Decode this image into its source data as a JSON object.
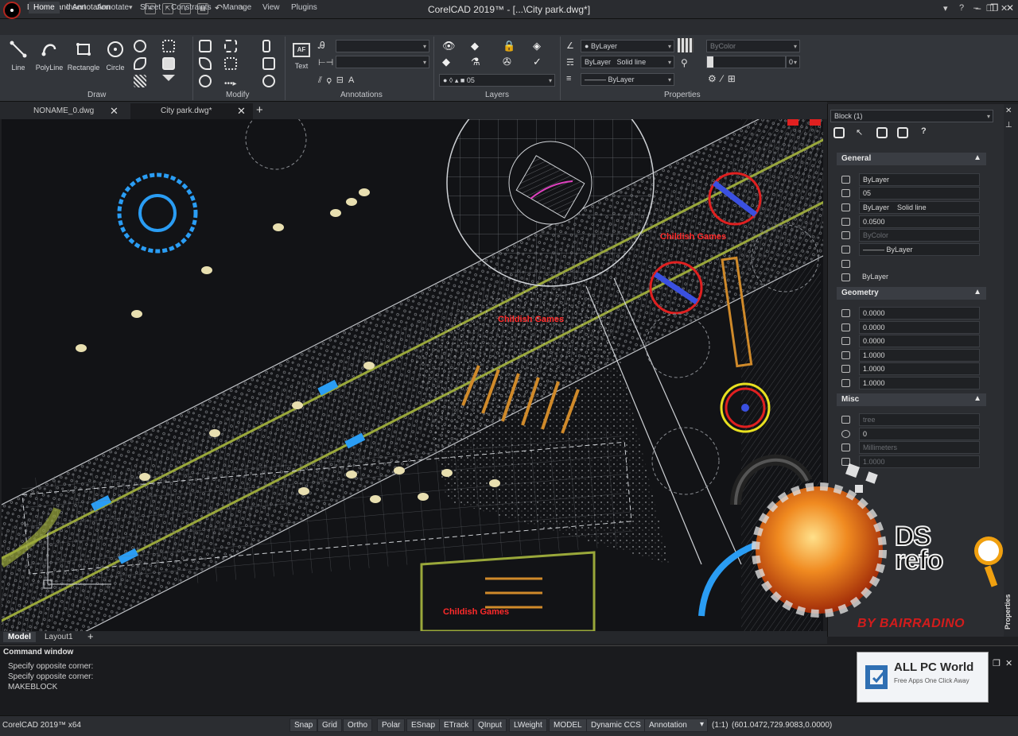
{
  "app": {
    "title": "CorelCAD 2019™ - [...\\City park.dwg*]",
    "workspace": "Drafting and Annotation",
    "window_controls": [
      "–",
      "❐",
      "✕"
    ],
    "doc_window_controls": [
      "▾",
      "?",
      "–",
      "❐",
      "✕"
    ]
  },
  "menu": {
    "tabs": [
      "Home",
      "Insert",
      "Annotate",
      "Sheet",
      "Constraints",
      "Manage",
      "View",
      "Plugins"
    ],
    "active": "Home"
  },
  "ribbon": {
    "draw": {
      "label": "Draw",
      "tools": [
        "Line",
        "PolyLine",
        "Rectangle",
        "Circle"
      ]
    },
    "modify": {
      "label": "Modify"
    },
    "annotations": {
      "label": "Annotations",
      "text_tool": "Text",
      "text_icon": "AF"
    },
    "layers": {
      "label": "Layers",
      "layer_combo": "05"
    },
    "properties": {
      "label": "Properties",
      "color_combo": "ByLayer",
      "linetype_combo": "ByLayer",
      "linetype_value": "Solid line",
      "lineweight_combo": "——— ByLayer",
      "bycolor_combo": "ByColor",
      "transparency_value": "0"
    }
  },
  "doc_tabs": [
    {
      "label": "NONAME_0.dwg"
    },
    {
      "label": "City park.dwg*"
    }
  ],
  "layout_tabs": [
    "Model",
    "Layout1"
  ],
  "canvas": {
    "annotations": [
      "Childish Games",
      "Childish Games",
      "Childish Games"
    ]
  },
  "properties_panel": {
    "selection": "Block (1)",
    "general_title": "General",
    "general": [
      "ByLayer",
      "05",
      "ByLayer",
      "Solid line",
      "0.0500",
      "ByColor",
      "——— ByLayer",
      "ByLayer"
    ],
    "geometry_title": "Geometry",
    "geometry": [
      "0.0000",
      "0.0000",
      "0.0000",
      "1.0000",
      "1.0000",
      "1.0000"
    ],
    "misc_title": "Misc",
    "misc": [
      "tree",
      "0",
      "Millimeters",
      "1.0000"
    ],
    "vertical_tab": "Properties"
  },
  "command_window": {
    "title": "Command window",
    "lines": [
      "Specify opposite corner:",
      "Specify opposite corner:",
      "MAKEBLOCK"
    ]
  },
  "status_bar": {
    "app_label": "CorelCAD 2019™ x64",
    "toggles": [
      "Snap",
      "Grid",
      "Ortho",
      "Polar",
      "ESnap",
      "ETrack",
      "QInput",
      "LWeight",
      "MODEL",
      "Dynamic CCS"
    ],
    "annotation": "Annotation",
    "scale": "(1:1)",
    "coords": "(601.0472,729.9083,0.0000)"
  },
  "watermarks": {
    "allpc_title": "ALL PC World",
    "allpc_sub": "Free Apps One Click Away",
    "ds_logo": "DS\nrefo",
    "bairradino": "BY BAIRRADINO"
  },
  "colors": {
    "background": "#121316",
    "ribbon": "#33363b",
    "accent_red": "#e02020",
    "cyan": "#2a9df4",
    "olive": "#9aa83a",
    "orange": "#d08a2a"
  }
}
